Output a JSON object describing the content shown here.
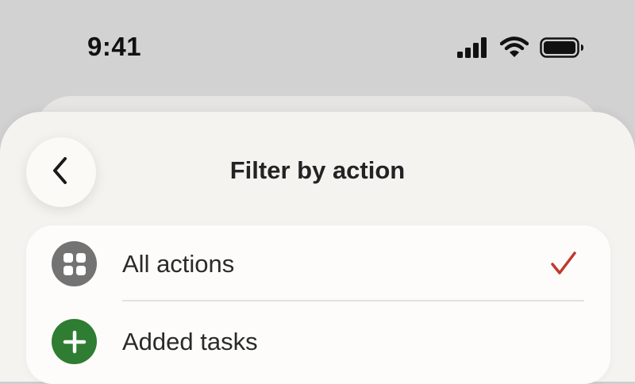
{
  "status_bar": {
    "time": "9:41",
    "icons": [
      "cellular-signal-icon",
      "wifi-icon",
      "battery-icon"
    ]
  },
  "header": {
    "back_icon": "chevron-left-icon",
    "title": "Filter by action"
  },
  "filter_list": {
    "items": [
      {
        "label": "All actions",
        "icon": "grid-icon",
        "icon_bg": "#737373",
        "selected": true
      },
      {
        "label": "Added tasks",
        "icon": "plus-icon",
        "icon_bg": "#2e7d32",
        "selected": false
      }
    ],
    "check_color": "#c0392b"
  }
}
